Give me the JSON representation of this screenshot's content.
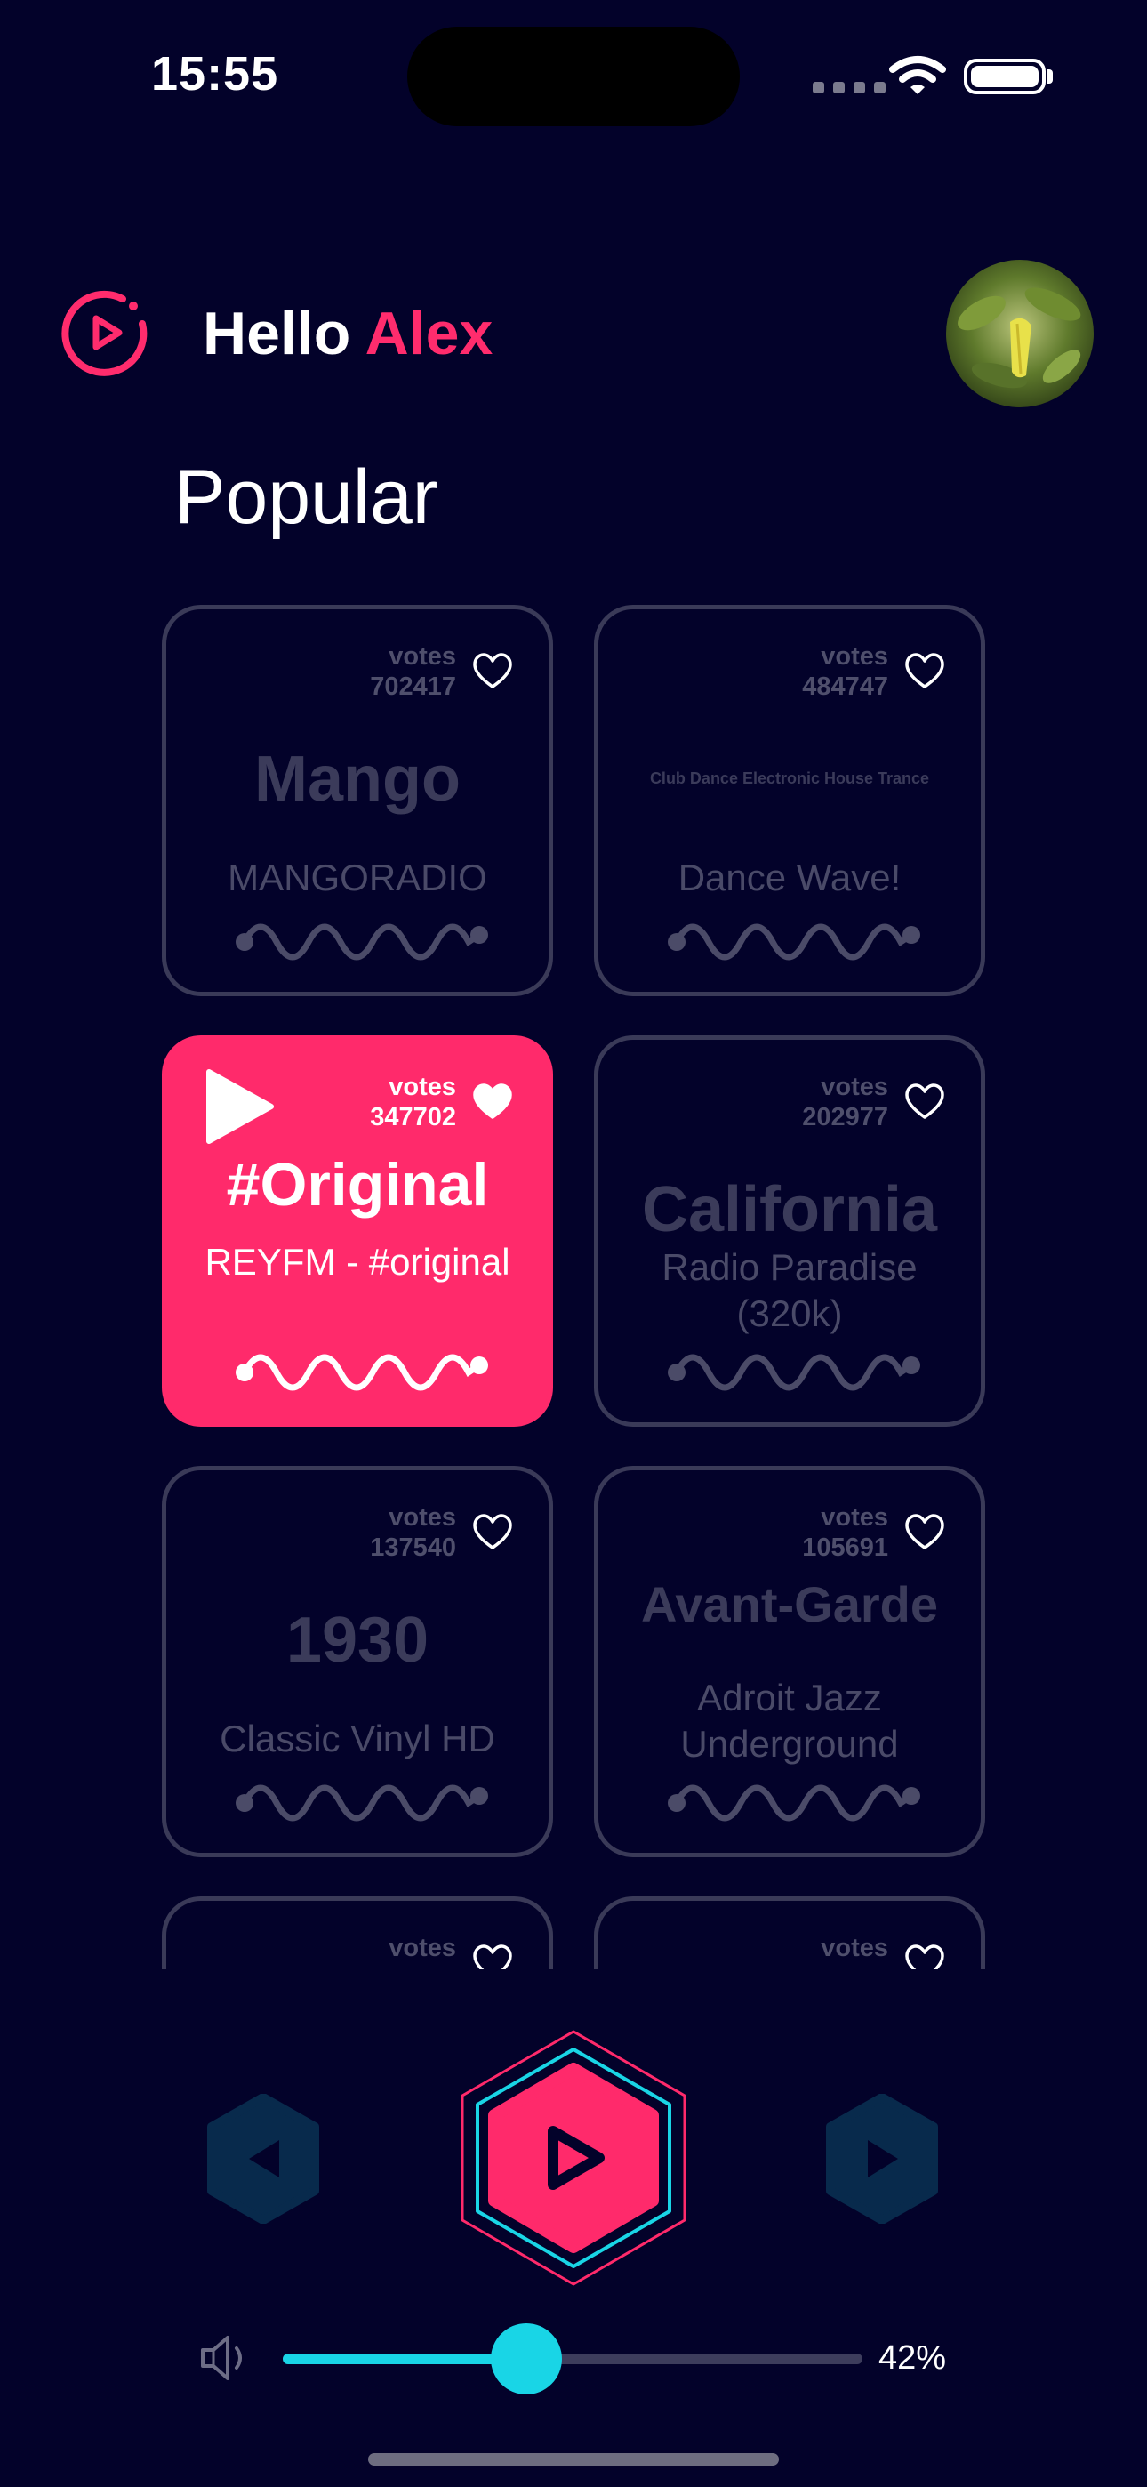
{
  "status_bar": {
    "time": "15:55"
  },
  "header": {
    "greeting": "Hello",
    "user_name": "Alex",
    "logo_icon": "play-circle-icon",
    "avatar_icon": "user-avatar-photo"
  },
  "section": {
    "title": "Popular"
  },
  "stations": [
    {
      "votes_label": "votes",
      "votes": "702417",
      "genre": "Mango",
      "station": "MANGORADIO",
      "liked": false,
      "active": false
    },
    {
      "votes_label": "votes",
      "votes": "484747",
      "genre": "Club Dance Electronic House Trance",
      "station": "Dance Wave!",
      "liked": false,
      "active": false
    },
    {
      "votes_label": "votes",
      "votes": "347702",
      "genre": "#Original",
      "station": "REYFM - #original",
      "liked": true,
      "active": true
    },
    {
      "votes_label": "votes",
      "votes": "202977",
      "genre": "California",
      "station": "Radio Paradise (320k)",
      "liked": false,
      "active": false
    },
    {
      "votes_label": "votes",
      "votes": "137540",
      "genre": "1930",
      "station": "Classic Vinyl HD",
      "liked": false,
      "active": false
    },
    {
      "votes_label": "votes",
      "votes": "105691",
      "genre": "Avant-Garde",
      "station": "Adroit Jazz Underground",
      "liked": false,
      "active": false
    },
    {
      "votes_label": "votes",
      "votes": "",
      "genre": "",
      "station": "",
      "liked": false,
      "active": false
    },
    {
      "votes_label": "votes",
      "votes": "",
      "genre": "",
      "station": "",
      "liked": false,
      "active": false
    }
  ],
  "player": {
    "prev_icon": "previous-icon",
    "play_icon": "play-icon",
    "next_icon": "next-icon",
    "volume_icon": "speaker-icon",
    "volume": 0.42,
    "volume_label": "42%"
  },
  "colors": {
    "background": "#03022a",
    "accent": "#ff2a6b",
    "cyan": "#19d5e6",
    "muted": "#3a3a58"
  }
}
